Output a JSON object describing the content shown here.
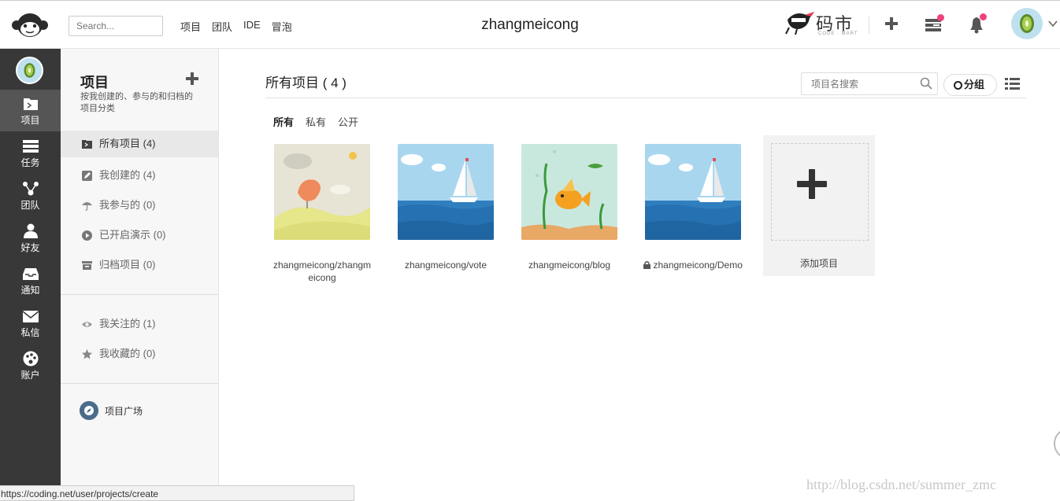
{
  "header": {
    "search_placeholder": "Search...",
    "nav": [
      "项目",
      "团队",
      "IDE",
      "冒泡"
    ],
    "username": "zhangmeicong",
    "brand_text": "码市",
    "brand_sub": "CODE · MART"
  },
  "rail": {
    "items": [
      {
        "label": "项目",
        "icon": "folder-icon"
      },
      {
        "label": "任务",
        "icon": "task-icon"
      },
      {
        "label": "团队",
        "icon": "team-icon"
      },
      {
        "label": "好友",
        "icon": "user-icon"
      },
      {
        "label": "通知",
        "icon": "inbox-icon"
      },
      {
        "label": "私信",
        "icon": "mail-icon"
      },
      {
        "label": "账户",
        "icon": "palette-icon"
      }
    ]
  },
  "sidebar": {
    "title": "项目",
    "description": "按我创建的、参与的和归档的项目分类",
    "items": [
      {
        "label": "所有项目 (4)",
        "icon": "folder-icon"
      },
      {
        "label": "我创建的 (4)",
        "icon": "edit-icon"
      },
      {
        "label": "我参与的 (0)",
        "icon": "umbrella-icon"
      },
      {
        "label": "已开启演示 (0)",
        "icon": "play-icon"
      },
      {
        "label": "归档项目 (0)",
        "icon": "archive-icon"
      }
    ],
    "extra_items": [
      {
        "label": "我关注的 (1)",
        "icon": "eye-icon"
      },
      {
        "label": "我收藏的 (0)",
        "icon": "star-icon"
      }
    ],
    "plaza": "项目广场"
  },
  "main": {
    "title": "所有项目 ( 4 )",
    "search_placeholder": "项目名搜索",
    "group_label": "分组",
    "filters": [
      "所有",
      "私有",
      "公开"
    ],
    "projects": [
      {
        "name": "zhangmeicong/zhangmeicong"
      },
      {
        "name": "zhangmeicong/vote"
      },
      {
        "name": "zhangmeicong/blog"
      },
      {
        "name": "zhangmeicong/Demo",
        "private": true
      }
    ],
    "add_label": "添加项目"
  },
  "status_url": "https://coding.net/user/projects/create",
  "watermark": "http://blog.csdn.net/summer_zmc",
  "colors": {
    "rail_bg": "#383838",
    "rail_active": "#555555",
    "badge": "#f0427a",
    "sidebar_bg": "#f7f7f7"
  }
}
